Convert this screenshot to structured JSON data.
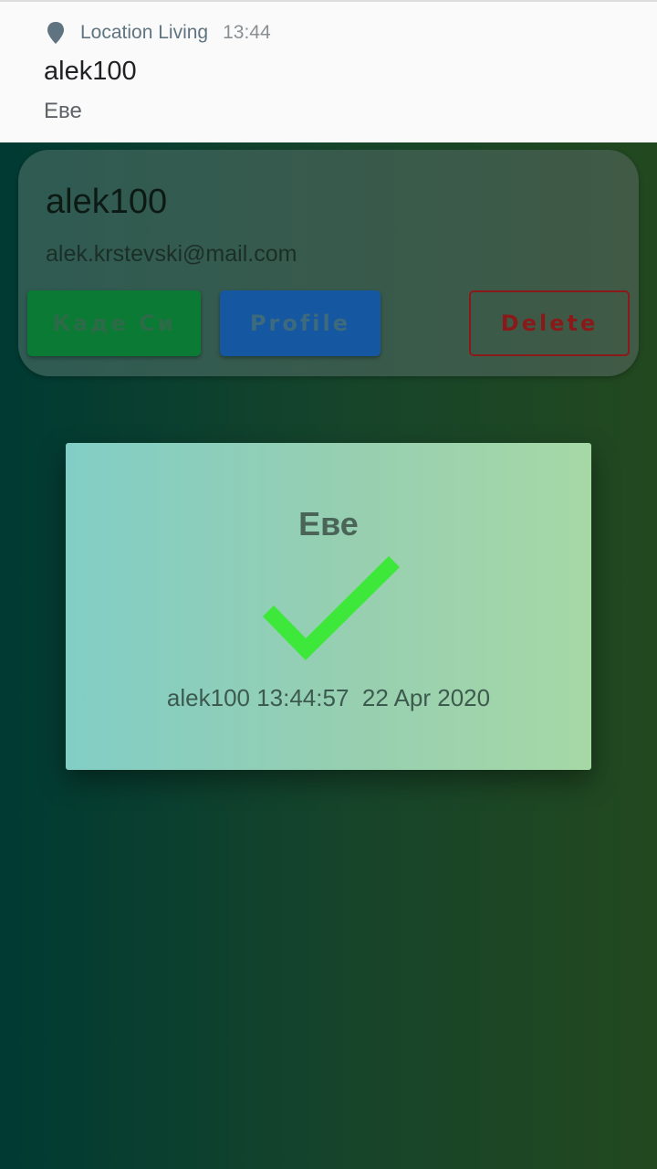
{
  "notification": {
    "app_name": "Location Living",
    "time": "13:44",
    "title": "alek100",
    "text": "Еве",
    "icon": "location-pin-icon"
  },
  "user_card": {
    "username": "alek100",
    "email": "alek.krstevski@mail.com",
    "buttons": {
      "kade_si": "Каде Си",
      "profile": "Profile",
      "delete": "Delete"
    }
  },
  "dialog": {
    "title": "Еве",
    "icon": "checkmark-icon",
    "info": "alek100 13:44:57  22 Apr 2020"
  },
  "colors": {
    "check": "#3de83a",
    "kade_button": "#0b7a35",
    "profile_button": "#1557a0",
    "delete_button": "#8a1a1a"
  }
}
